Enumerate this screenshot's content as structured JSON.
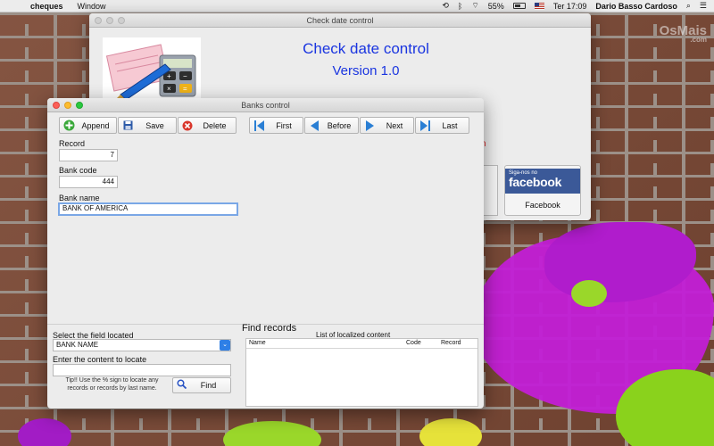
{
  "menubar": {
    "app_name": "cheques",
    "menu_items": [
      "Window"
    ],
    "battery": "55%",
    "clock": "Ter 17:09",
    "user": "Dario Basso Cardoso"
  },
  "desktop": {
    "brand_main": "OsMais",
    "brand_sub": ".com"
  },
  "main_window": {
    "title": "Check date control",
    "heading": "Check date control",
    "version": "Version 1.0",
    "red_fragment": "n",
    "facebook": {
      "small": "Siga-nos no",
      "logo": "facebook",
      "label": "Facebook"
    }
  },
  "banks_window": {
    "title": "Banks control",
    "toolbar": {
      "append": "Append",
      "save": "Save",
      "delete": "Delete",
      "first": "First",
      "before": "Before",
      "next": "Next",
      "last": "Last"
    },
    "fields": {
      "record_label": "Record",
      "record_value": "7",
      "bank_code_label": "Bank code",
      "bank_code_value": "444",
      "bank_name_label": "Bank name",
      "bank_name_value": "BANK OF AMERICA"
    },
    "search": {
      "field_label": "Select the field located",
      "field_value": "BANK NAME",
      "content_label": "Enter the content to locate",
      "content_value": "",
      "tip": "Tip!! Use the % sign to locate any records or records by last name.",
      "find_button": "Find",
      "find_title": "Find records",
      "list_title": "List of localized content",
      "columns": [
        "Name",
        "Code",
        "Record"
      ]
    }
  },
  "colors": {
    "title_blue": "#1a35e0",
    "facebook_blue": "#3b5998",
    "focus_ring": "#7aa7e6"
  }
}
